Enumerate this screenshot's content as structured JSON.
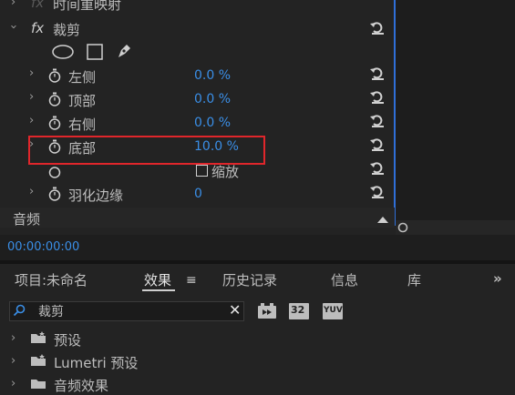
{
  "effect_controls": {
    "time_remap_label": "时间重映射",
    "crop_label": "裁剪",
    "params": [
      {
        "label": "左侧",
        "value": "0.0 %"
      },
      {
        "label": "顶部",
        "value": "0.0 %"
      },
      {
        "label": "右侧",
        "value": "0.0 %"
      },
      {
        "label": "底部",
        "value": "10.0 %"
      }
    ],
    "zoom_label": "缩放",
    "feather_label": "羽化边缘",
    "feather_value": "0",
    "audio_label": "音频"
  },
  "timecode": "00:00:00:00",
  "tabs": {
    "project": "项目:未命名",
    "effects": "效果",
    "history": "历史记录",
    "info": "信息",
    "library": "库",
    "more": "»"
  },
  "search": {
    "value": "裁剪"
  },
  "badges": {
    "b32": "32",
    "yuv": "YUV"
  },
  "tree": {
    "presets": "预设",
    "lumetri": "Lumetri 预设",
    "audio_effects": "音频效果"
  },
  "colors": {
    "accent": "#3a8ee6",
    "highlight": "#e0262b",
    "panel": "#232323"
  }
}
